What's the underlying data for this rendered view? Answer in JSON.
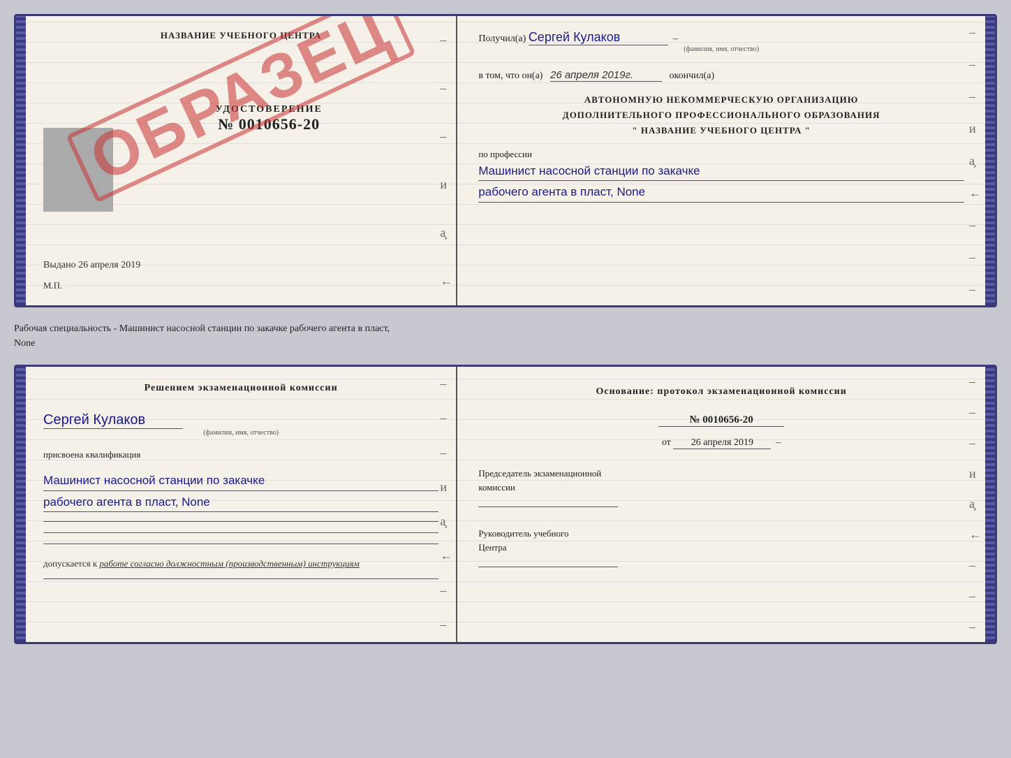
{
  "doc1": {
    "left": {
      "center_title": "НАЗВАНИЕ УЧЕБНОГО ЦЕНТРА",
      "stamp": "ОБРАЗЕЦ",
      "udost_title": "УДОСТОВЕРЕНИЕ",
      "udost_num": "№ 0010656-20",
      "vydano": "Выдано 26 апреля 2019",
      "mp": "М.П."
    },
    "right": {
      "received_label": "Получил(а)",
      "received_name": "Сергей Кулаков",
      "fio_label": "(фамилия, имя, отчество)",
      "date_label": "в том, что он(а)",
      "date_value": "26 апреля 2019г.",
      "date_suffix": "окончил(а)",
      "org_line1": "АВТОНОМНУЮ НЕКОММЕРЧЕСКУЮ ОРГАНИЗАЦИЮ",
      "org_line2": "ДОПОЛНИТЕЛЬНОГО ПРОФЕССИОНАЛЬНОГО ОБРАЗОВАНИЯ",
      "org_line3": "\" НАЗВАНИЕ УЧЕБНОГО ЦЕНТРА \"",
      "profession_label": "по профессии",
      "profession_line1": "Машинист насосной станции по закачке",
      "profession_line2": "рабочего агента в пласт, None"
    }
  },
  "between": {
    "text": "Рабочая специальность - Машинист насосной станции по закачке рабочего агента в пласт,",
    "text2": "None"
  },
  "doc2": {
    "left": {
      "komissia_title": "Решением экзаменационной комиссии",
      "name_handwritten": "Сергей Кулаков",
      "fio_label": "(фамилия, имя, отчество)",
      "assigned_label": "присвоена квалификация",
      "qual_line1": "Машинист насосной станции по закачке",
      "qual_line2": "рабочего агента в пласт, None",
      "допускается_label": "допускается к",
      "допускается_value": "работе согласно должностным (производственным) инструкциям"
    },
    "right": {
      "osnov_title": "Основание: протокол экзаменационной комиссии",
      "protocol_num": "№ 0010656-20",
      "from_label": "от",
      "from_date": "26 апреля 2019",
      "chairman_label": "Председатель экзаменационной",
      "chairman_label2": "комиссии",
      "rukovod_label": "Руководитель учебного",
      "rukovod_label2": "Центра"
    }
  }
}
